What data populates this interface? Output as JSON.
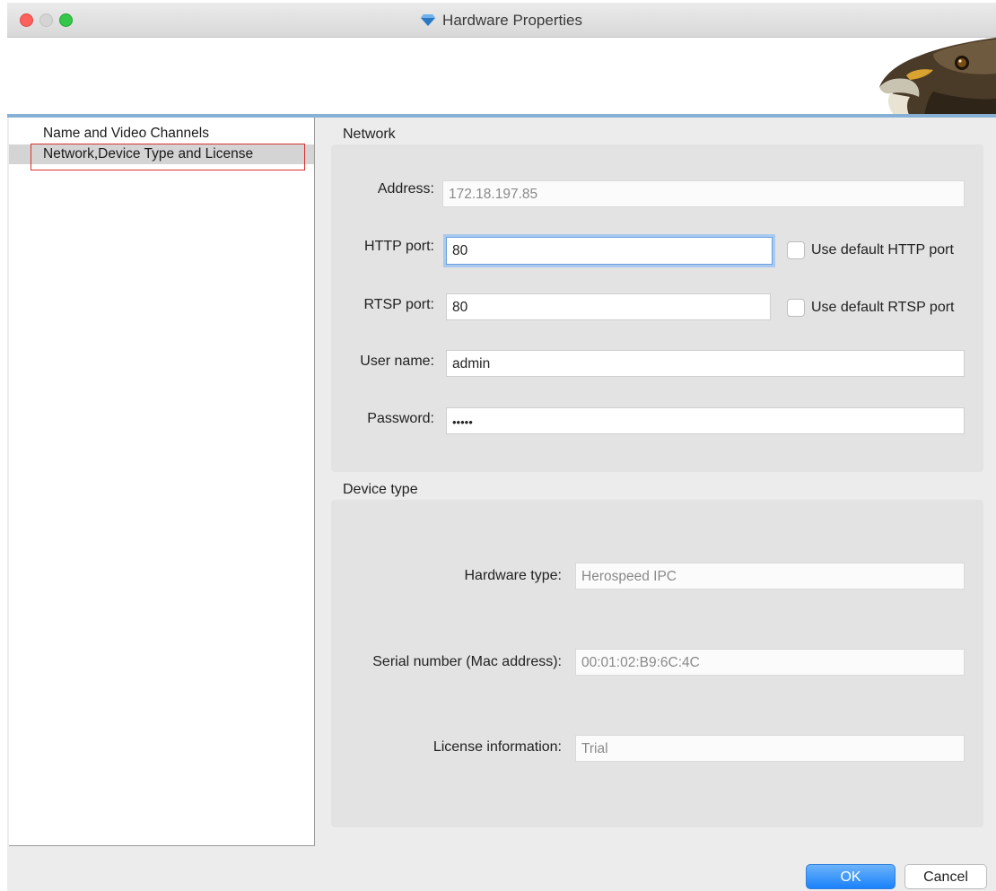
{
  "window": {
    "title": "Hardware Properties"
  },
  "nav": {
    "items": [
      {
        "label": "Name and Video Channels",
        "selected": false
      },
      {
        "label": "Network,Device Type and License",
        "selected": true
      }
    ]
  },
  "network": {
    "group_label": "Network",
    "address": {
      "label": "Address:",
      "value": "172.18.197.85"
    },
    "http_port": {
      "label": "HTTP port:",
      "value": "80",
      "checkbox_label": "Use default HTTP port",
      "checked": false
    },
    "rtsp_port": {
      "label": "RTSP port:",
      "value": "80",
      "checkbox_label": "Use default RTSP port",
      "checked": false
    },
    "user_name": {
      "label": "User name:",
      "value": "admin"
    },
    "password": {
      "label": "Password:",
      "value": "•••••"
    }
  },
  "device": {
    "group_label": "Device type",
    "hardware_type": {
      "label": "Hardware type:",
      "value": "Herospeed IPC"
    },
    "serial_number": {
      "label": "Serial number (Mac address):",
      "value": "00:01:02:B9:6C:4C"
    },
    "license": {
      "label": "License information:",
      "value": "Trial"
    }
  },
  "buttons": {
    "ok": "OK",
    "cancel": "Cancel"
  },
  "colors": {
    "accent": "#1a82fb",
    "highlight_box": "#d93030",
    "banner_line": "#86b0d6"
  }
}
